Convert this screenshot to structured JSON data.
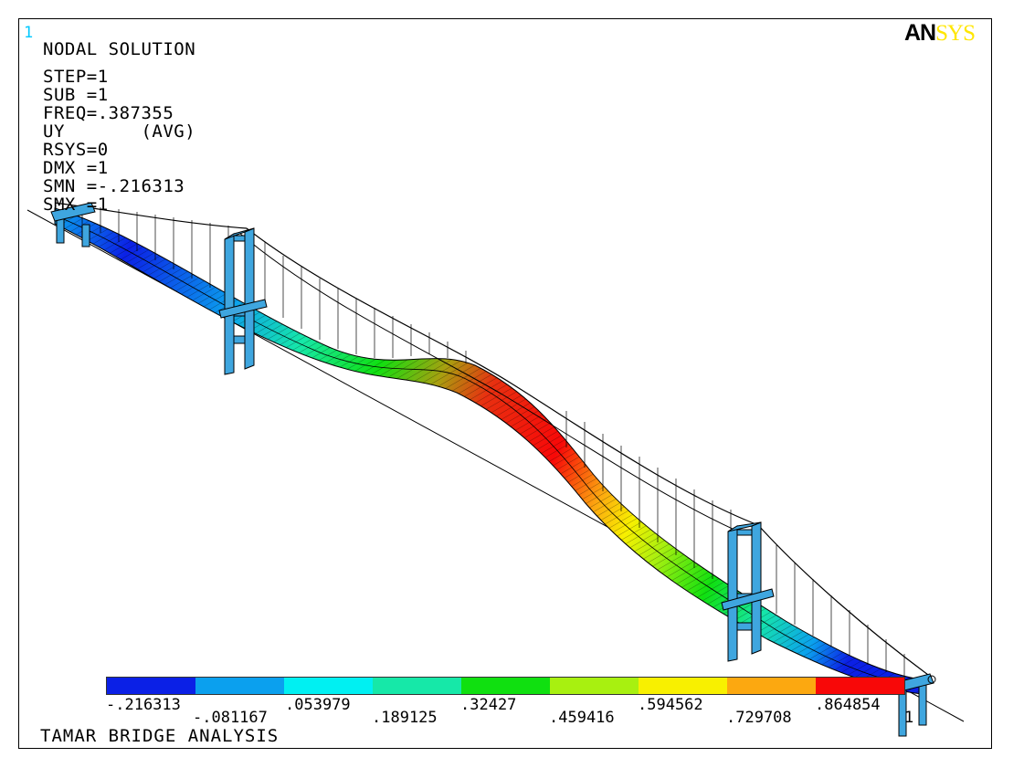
{
  "window_number": "1",
  "logo": {
    "an": "AN",
    "sys": "SYS"
  },
  "header_lines": [
    "NODAL SOLUTION",
    "STEP=1",
    "SUB =1",
    "FREQ=.387355",
    "UY       (AVG)",
    "RSYS=0",
    "DMX =1",
    "SMN =-.216313",
    "SMX =1"
  ],
  "legend": {
    "colors": [
      "#0b20e6",
      "#0ba0ee",
      "#00f0f2",
      "#16e8a8",
      "#10e010",
      "#a8f010",
      "#f8f000",
      "#fca810",
      "#f80808"
    ],
    "labels": [
      "-.216313",
      "-.081167",
      ".053979",
      ".189125",
      ".32427",
      ".459416",
      ".594562",
      ".729708",
      ".864854",
      "1"
    ]
  },
  "footer_title": "TAMAR BRIDGE ANALYSIS",
  "colors": {
    "tower": "#3fa6df",
    "outline": "#000000"
  }
}
